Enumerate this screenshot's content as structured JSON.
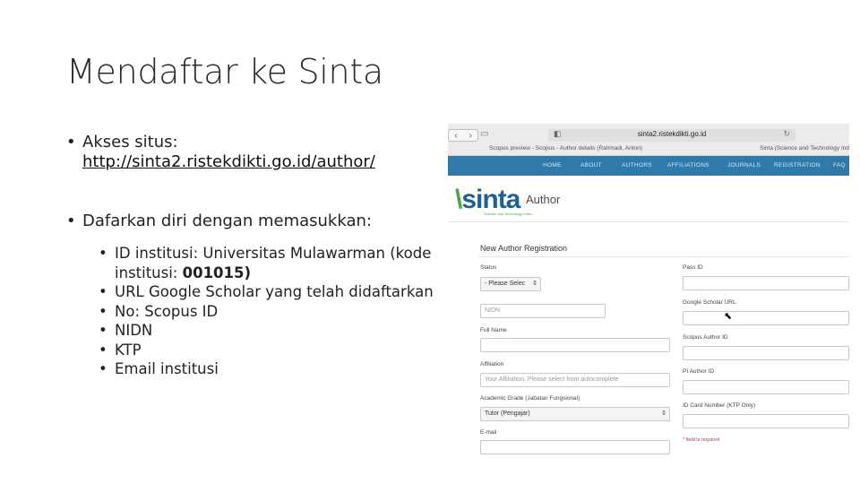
{
  "slide": {
    "title": "Mendaftar ke Sinta",
    "bullet1_label": "Akses situs:",
    "bullet1_link": "http://sinta2.ristekdikti.go.id/author/",
    "bullet2": "Dafarkan diri dengan memasukkan:",
    "sub1_text": "ID institusi: Universitas Mulawarman (kode institusi: ",
    "sub1_code": "001015)",
    "sub2": "URL Google Scholar yang telah didaftarkan",
    "sub3": "No: Scopus ID",
    "sub4": "NIDN",
    "sub5": "KTP",
    "sub6": "Email institusi"
  },
  "browser": {
    "url": "sinta2.ristekdikti.go.id",
    "tab1": "Scopus preview - Scopus - Author details (Rahmadi, Anton)",
    "tab2": "Sinta (Science and Technology Index)"
  },
  "site_nav": [
    "HOME",
    "ABOUT",
    "AUTHORS",
    "AFFILIATIONS",
    "JOURNALS",
    "REGISTRATION",
    "FAQ"
  ],
  "site": {
    "logo": "sinta",
    "logo_sub": "Science and Technology Index",
    "page_label": "Author"
  },
  "form": {
    "title": "New Author Registration",
    "status_label": "Status",
    "status_value": "- Please Selec",
    "nidn_placeholder": "NIDN",
    "fullname_label": "Full Name",
    "affiliation_label": "Affiliation",
    "affiliation_placeholder": "Your Affiliation. Please select from autocomplete",
    "academic_label": "Academic Grade (Jabatan Fungsional)",
    "academic_value": "Tutor (Pengajar)",
    "email_label": "E-mail",
    "pass_label": "Pass ID",
    "gscholar_label": "Google Scholar URL",
    "scopus_label": "Scopus Author ID",
    "pi_label": "PI Author ID",
    "idcard_label": "ID Card Number (KTP Only)",
    "required_note": "* field is required"
  }
}
